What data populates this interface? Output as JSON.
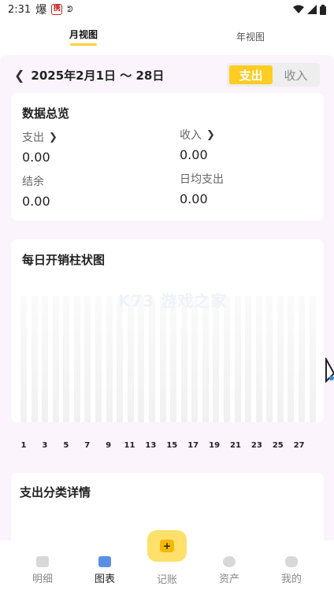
{
  "status_bar": {
    "time": "2:31",
    "flame_glyph": "爆",
    "badge_text": "携",
    "sync_glyph": "ᕲ"
  },
  "top_tabs": [
    {
      "label": "月视图",
      "active": true
    },
    {
      "label": "年视图",
      "active": false
    }
  ],
  "date_bar": {
    "range": "2025年2月1日 ～ 28日",
    "toggle": [
      {
        "label": "支出",
        "active": true
      },
      {
        "label": "收入",
        "active": false
      }
    ]
  },
  "overview": {
    "title": "数据总览",
    "expense_label": "支出",
    "expense_value": "0.00",
    "income_label": "收入",
    "income_value": "0.00",
    "balance_label": "结余",
    "balance_value": "0.00",
    "daily_label": "日均支出",
    "daily_value": "0.00"
  },
  "chart_data": {
    "type": "bar",
    "title": "每日开销柱状图",
    "watermark": "K73 游戏之家",
    "bar_count": 28,
    "tick_labels": [
      "1",
      "3",
      "5",
      "7",
      "9",
      "11",
      "13",
      "15",
      "17",
      "19",
      "21",
      "23",
      "25",
      "27"
    ],
    "values": [
      0,
      0,
      0,
      0,
      0,
      0,
      0,
      0,
      0,
      0,
      0,
      0,
      0,
      0,
      0,
      0,
      0,
      0,
      0,
      0,
      0,
      0,
      0,
      0,
      0,
      0,
      0,
      0
    ]
  },
  "detail": {
    "title": "支出分类详情"
  },
  "bottom_nav": {
    "items": [
      {
        "label": "明细",
        "active": false
      },
      {
        "label": "图表",
        "active": true
      },
      {
        "label": "资产",
        "active": false
      },
      {
        "label": "我的",
        "active": false
      }
    ],
    "fab_label": "记账",
    "fab_glyph": "+"
  },
  "colors": {
    "accent": "#ffcc22",
    "content_bg": "#fbf4fc",
    "active_icon": "#5b8fe6"
  }
}
